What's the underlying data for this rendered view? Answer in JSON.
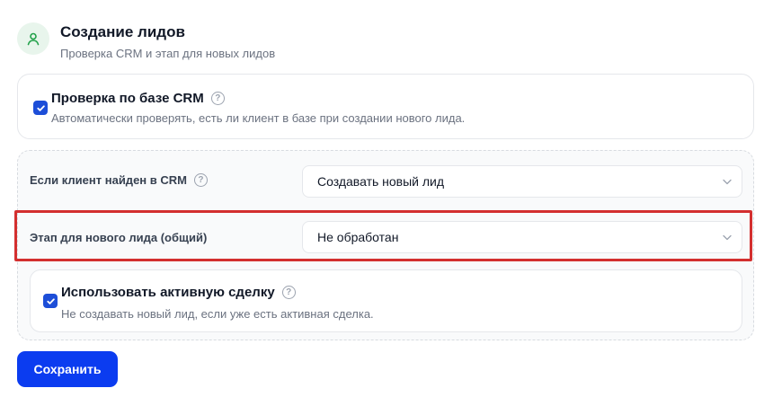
{
  "header": {
    "icon": "user-icon",
    "title": "Создание лидов",
    "subtitle": "Проверка CRM и этап для новых лидов"
  },
  "crm_check": {
    "checked": true,
    "title": "Проверка по базе CRM",
    "help_glyph": "?",
    "description": "Автоматически проверять, есть ли клиент в базе при создании нового лида."
  },
  "rows": [
    {
      "label": "Если клиент найден в CRM",
      "has_help": true,
      "help_glyph": "?",
      "value": "Создавать новый лид"
    },
    {
      "label": "Этап для нового лида (общий)",
      "has_help": false,
      "value": "Не обработан"
    }
  ],
  "active_deal": {
    "checked": true,
    "title": "Использовать активную сделку",
    "help_glyph": "?",
    "description": "Не создавать новый лид, если уже есть активная сделка."
  },
  "save_label": "Сохранить",
  "colors": {
    "accent": "#0b3cf0",
    "checkbox": "#1d4ed8",
    "highlight": "#d32f2f",
    "icon_bg": "#e8f5ec",
    "icon_fg": "#22a14a"
  }
}
